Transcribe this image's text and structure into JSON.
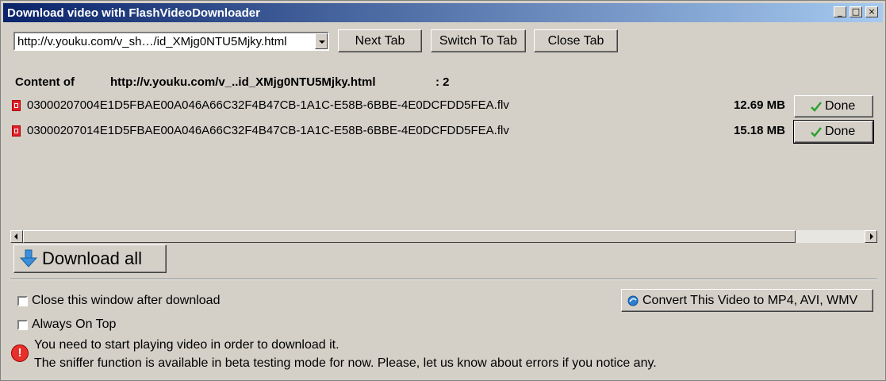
{
  "window": {
    "title": "Download video with FlashVideoDownloader",
    "minimize_glyph": "_",
    "maximize_glyph": "□",
    "close_glyph": "×"
  },
  "toolbar": {
    "url_value": "http://v.youku.com/v_sh…/id_XMjg0NTU5Mjky.html",
    "next_tab": "Next Tab",
    "switch_to_tab": "Switch To Tab",
    "close_tab": "Close Tab"
  },
  "content": {
    "label": "Content of",
    "url": "http://v.youku.com/v_..id_XMjg0NTU5Mjky.html",
    "count": ": 2"
  },
  "files": [
    {
      "name": "03000207004E1D5FBAE00A046A66C32F4B47CB-1A1C-E58B-6BBE-4E0DCFDD5FEA.flv",
      "size": "12.69 MB",
      "status": "Done"
    },
    {
      "name": "03000207014E1D5FBAE00A046A66C32F4B47CB-1A1C-E58B-6BBE-4E0DCFDD5FEA.flv",
      "size": "15.18 MB",
      "status": "Done"
    }
  ],
  "download_all": "Download all",
  "options": {
    "close_after": "Close this window after download",
    "always_on_top": "Always On Top",
    "convert_button": "Convert This Video to MP4, AVI, WMV"
  },
  "notice": {
    "line1": "You need to start playing video in order to download it.",
    "line2": "The sniffer function is available in beta testing mode for now. Please, let us know about errors if you notice any."
  },
  "icons": {
    "download_arrow": "down-arrow-icon",
    "check": "check-icon",
    "file": "flv-file-icon",
    "error": "error-icon",
    "convert": "convert-icon"
  },
  "colors": {
    "titlebar_start": "#0a246a",
    "titlebar_end": "#a6caf0",
    "window_bg": "#d4d0c8",
    "check_green": "#2ea02e",
    "error_red": "#e8302a"
  }
}
